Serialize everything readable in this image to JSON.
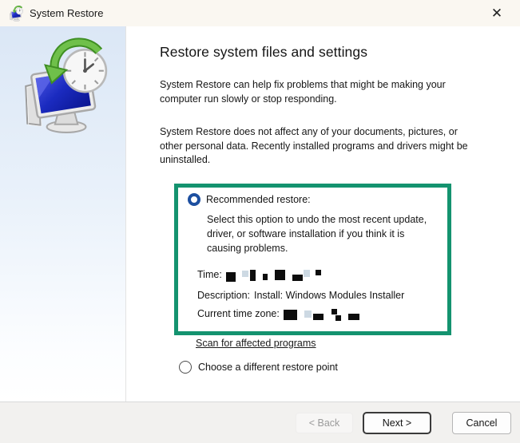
{
  "window": {
    "title": "System Restore"
  },
  "icons": {
    "close": "✕"
  },
  "main": {
    "heading": "Restore system files and settings",
    "paragraphs": [
      "System Restore can help fix problems that might be making your computer run slowly or stop responding.",
      "System Restore does not affect any of your documents, pictures, or other personal data. Recently installed programs and drivers might be uninstalled."
    ]
  },
  "recommended": {
    "label": "Recommended restore:",
    "description": "Select this option to undo the most recent update, driver, or software installation if you think it is causing problems.",
    "time_label": "Time:",
    "desc_label": "Description:",
    "desc_value": "Install: Windows Modules Installer",
    "timezone_label": "Current time zone:",
    "selected": true
  },
  "scan_link": "Scan for affected programs",
  "alternate": {
    "label": "Choose a different restore point",
    "selected": false
  },
  "footer": {
    "back": "< Back",
    "next": "Next >",
    "cancel": "Cancel"
  },
  "colors": {
    "highlight_border": "#14936F",
    "radio_selected": "#1D4FA0",
    "screen_blue": "#1B2BC0",
    "arrow_green": "#63B53C"
  }
}
